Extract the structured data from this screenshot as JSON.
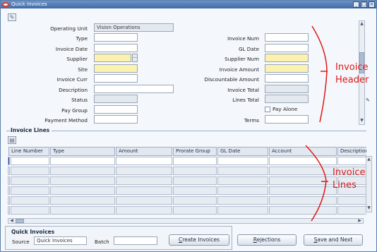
{
  "window": {
    "title": "Quick Invoices",
    "controls": [
      "_",
      "□",
      "×"
    ]
  },
  "header": {
    "operating_unit_label": "Operating Unit",
    "operating_unit_value": "Vision Operations",
    "type_label": "Type",
    "invoice_date_label": "Invoice Date",
    "supplier_label": "Supplier",
    "site_label": "Site",
    "invoice_curr_label": "Invoice Curr",
    "description_label": "Description",
    "status_label": "Status",
    "pay_group_label": "Pay Group",
    "payment_method_label": "Payment Method",
    "invoice_num_label": "Invoice Num",
    "gl_date_label": "GL Date",
    "supplier_num_label": "Supplier Num",
    "invoice_amount_label": "Invoice Amount",
    "discountable_amount_label": "Discountable Amount",
    "invoice_total_label": "Invoice Total",
    "lines_total_label": "Lines Total",
    "pay_alone_label": "Pay Alone",
    "terms_label": "Terms",
    "lov_button": "...",
    "pay_alone_checked": false
  },
  "lines": {
    "section_title": "Invoice Lines",
    "columns": [
      "Line Number",
      "Type",
      "Amount",
      "Prorate Group",
      "GL Date",
      "Account",
      "Description"
    ]
  },
  "footer": {
    "section_title": "Quick Invoices",
    "source_label": "Source",
    "source_value": "Quick Invoices",
    "batch_label": "Batch",
    "batch_value": "",
    "create_invoices_btn": "Create Invoices",
    "rejections_btn": "Rejections",
    "save_next_btn": "Save and Next"
  },
  "annotations": {
    "header_line1": "Invoice",
    "header_line2": "Header",
    "lines_line1": "Invoice",
    "lines_line2": "Lines"
  },
  "colors": {
    "required_field": "#fdf1b0",
    "annotation": "#e01818",
    "title_bar": "#3f6aa6"
  }
}
